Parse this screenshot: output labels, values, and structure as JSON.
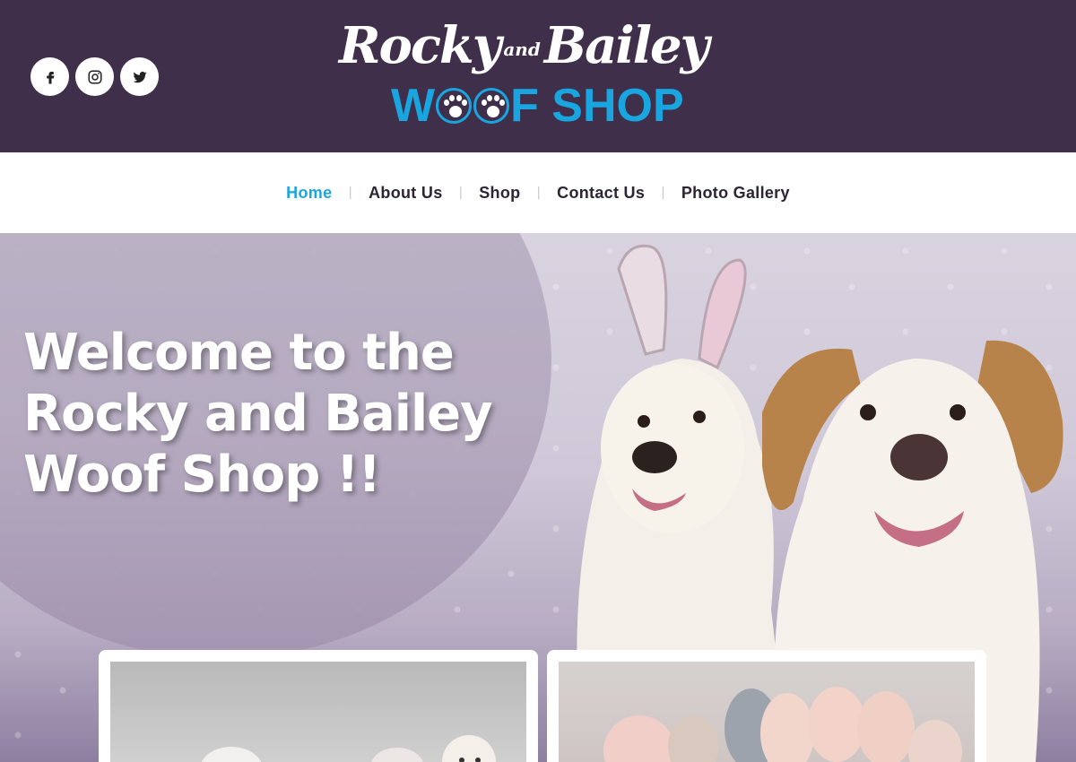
{
  "header": {
    "background": "#3f2f4a",
    "social": [
      {
        "name": "facebook-icon"
      },
      {
        "name": "instagram-icon"
      },
      {
        "name": "twitter-icon"
      }
    ],
    "logo": {
      "line1_left": "Rocky",
      "line1_and": "and",
      "line1_right": "Bailey",
      "line2_w": "W",
      "line2_rest": "F SHOP",
      "accent_color": "#18a5e0"
    }
  },
  "nav": {
    "items": [
      {
        "label": "Home",
        "active": true
      },
      {
        "label": "About Us"
      },
      {
        "label": "Shop"
      },
      {
        "label": "Contact Us"
      },
      {
        "label": "Photo Gallery"
      }
    ],
    "separator": "|",
    "active_color": "#1aa7e0"
  },
  "hero": {
    "title": "Welcome to the Rocky and Bailey Woof Shop !!"
  }
}
